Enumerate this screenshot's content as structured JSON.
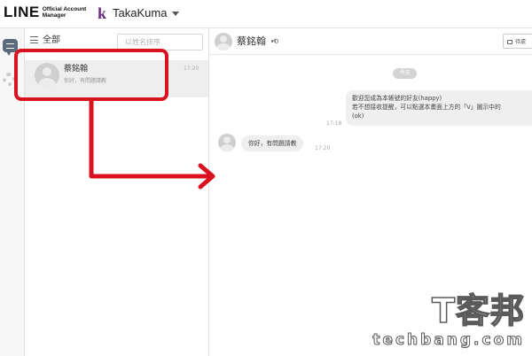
{
  "header": {
    "logo_text": "LINE",
    "logo_sub_line1": "Official Account",
    "logo_sub_line2": "Manager",
    "account_initial": "k",
    "account_name": "TakaKuma"
  },
  "sidebar": {
    "items": [
      {
        "icon": "chat-icon",
        "active": true
      },
      {
        "icon": "gear-icon",
        "active": false
      }
    ]
  },
  "conversation_list": {
    "filter_label": "全部",
    "search_placeholder": "以姓名排序",
    "items": [
      {
        "name": "蔡銘翰",
        "preview": "你好，有問題請教",
        "time": "17:20"
      }
    ]
  },
  "chat": {
    "contact_name": "蔡銘翰",
    "status_button": "待處",
    "day_separator": "今天",
    "messages": [
      {
        "direction": "outgoing",
        "lines": [
          "歡迎您成為本帳號的好友(happy)",
          "若不想接收提醒，可以點選本畫面上方的「V」圖示中的",
          "(ok)"
        ],
        "time": "17:18"
      },
      {
        "direction": "incoming",
        "text": "你好，有問題請教",
        "time": "17:20"
      }
    ]
  },
  "annotation": {
    "color": "#d9121f"
  },
  "watermark": {
    "chinese": "T客邦",
    "english": "techbang.com"
  }
}
